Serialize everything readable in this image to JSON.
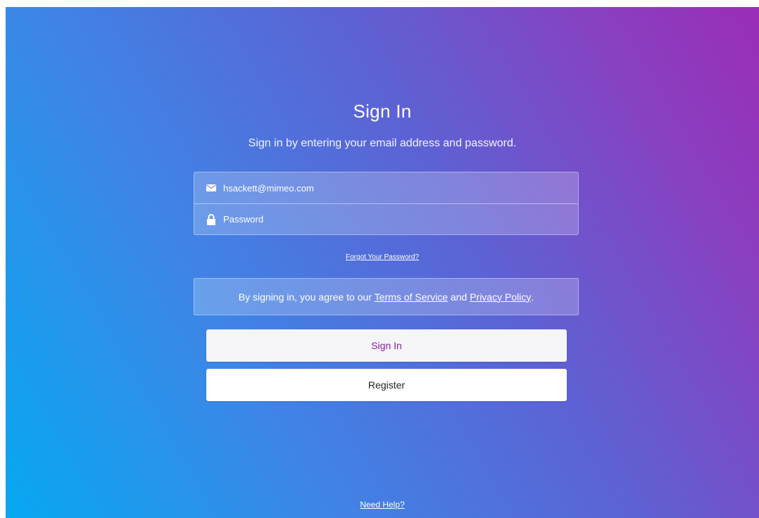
{
  "header": {
    "title": "Sign In",
    "subtitle": "Sign in by entering your email address and password."
  },
  "form": {
    "email": {
      "value": "hsackett@mimeo.com",
      "placeholder": "",
      "icon": "envelope-icon"
    },
    "password": {
      "value": "",
      "placeholder": "Password",
      "icon": "lock-icon"
    },
    "forgot_link": "Forgot Your Password?"
  },
  "agreement": {
    "prefix": "By signing in, you agree to our ",
    "terms_link": "Terms of Service",
    "middle": " and ",
    "privacy_link": "Privacy Policy",
    "suffix": "."
  },
  "buttons": {
    "sign_in": "Sign In",
    "register": "Register"
  },
  "footer": {
    "help_link": "Need Help?"
  },
  "colors": {
    "gradient_start": "#06a8f2",
    "gradient_end": "#9a2db8",
    "sign_in_text": "#8a1f9a"
  }
}
